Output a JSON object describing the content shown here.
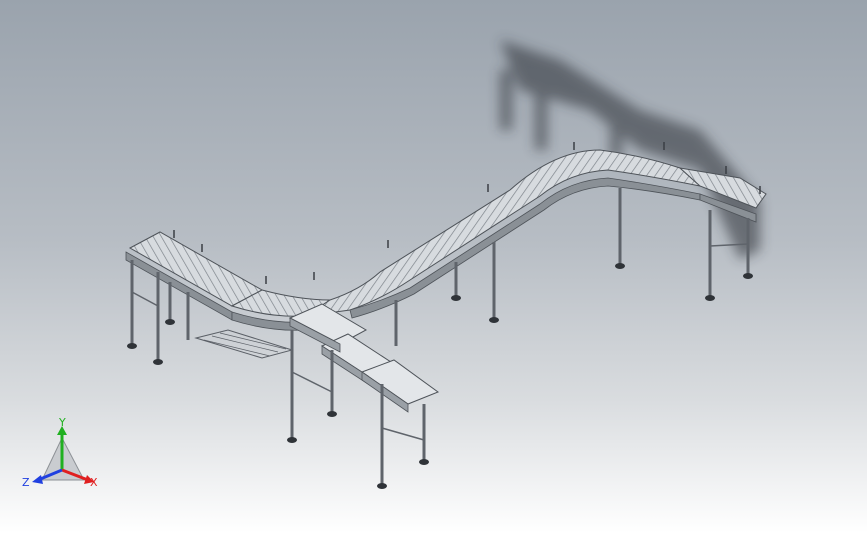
{
  "viewport": {
    "background_top": "#9aa3ad",
    "background_bottom": "#ffffff"
  },
  "triad": {
    "x_label": "X",
    "y_label": "Y",
    "z_label": "Z",
    "x_color": "#e02020",
    "y_color": "#20b020",
    "z_color": "#2040e0"
  },
  "model": {
    "description_icon": "roller-conveyor-assembly",
    "frame_color": "#6e737a",
    "roller_color": "#d7dbdf",
    "belt_color": "#c8ccd0",
    "shadow_color": "#2b2f36"
  }
}
